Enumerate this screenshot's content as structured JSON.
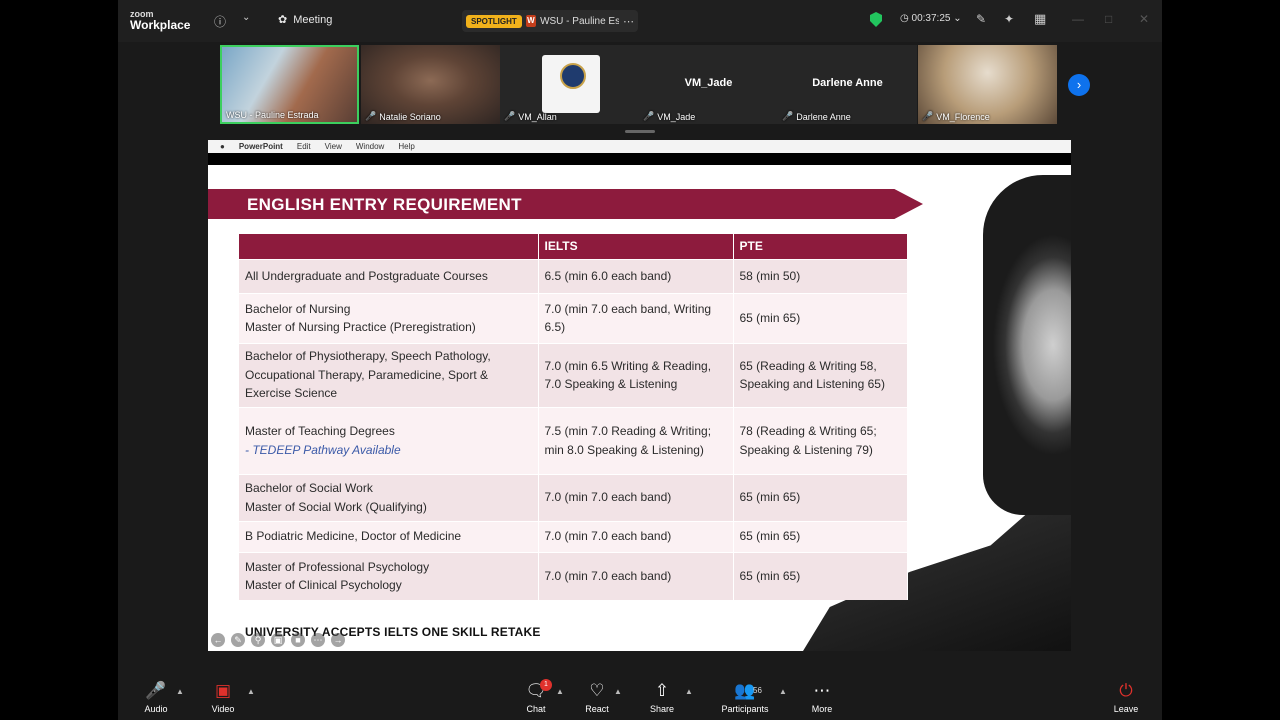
{
  "app": {
    "logo_top": "zoom",
    "logo_bottom": "Workplace"
  },
  "titlebar": {
    "meeting_label": "Meeting",
    "spotlight_badge": "SPOTLIGHT",
    "spotlight_title": "WSU - Pauline Es",
    "timer": "00:37:25",
    "icons": [
      "info-icon",
      "chevron-down-icon",
      "meeting-icon",
      "shield-icon",
      "clock-icon",
      "pencil-icon",
      "sparkle-icon",
      "grid-icon"
    ]
  },
  "participants_strip": [
    {
      "name": "WSU - Pauline Estrada",
      "muted": false,
      "type": "video"
    },
    {
      "name": "Natalie Soriano",
      "muted": true,
      "type": "video"
    },
    {
      "name": "VM_Allan",
      "muted": true,
      "type": "logo"
    },
    {
      "name": "VM_Jade",
      "muted": true,
      "type": "name",
      "display": "VM_Jade"
    },
    {
      "name": "Darlene Anne",
      "muted": true,
      "type": "name",
      "display": "Darlene Anne"
    },
    {
      "name": "VM_Florence",
      "muted": true,
      "type": "video"
    }
  ],
  "macbar": {
    "app": "PowerPoint",
    "menus": [
      "Edit",
      "View",
      "Window",
      "Help"
    ]
  },
  "slide": {
    "title": "ENGLISH ENTRY REQUIREMENT",
    "headers": [
      "",
      "IELTS",
      "PTE"
    ],
    "rows": [
      {
        "course": [
          "All Undergraduate and Postgraduate Courses"
        ],
        "ielts": [
          "6.5 (min 6.0 each band)"
        ],
        "pte": [
          "58 (min 50)"
        ]
      },
      {
        "course": [
          "Bachelor of Nursing",
          "Master of Nursing Practice (Preregistration)"
        ],
        "ielts": [
          "7.0 (min 7.0 each band, Writing",
          "6.5)"
        ],
        "pte": [
          "65 (min 65)"
        ]
      },
      {
        "course": [
          "Bachelor of Physiotherapy, Speech Pathology,",
          "Occupational Therapy, Paramedicine, Sport &",
          "Exercise Science"
        ],
        "ielts": [
          "7.0 (min 6.5 Writing & Reading,",
          "7.0 Speaking & Listening"
        ],
        "pte": [
          "65 (Reading & Writing 58,",
          "Speaking and Listening 65)"
        ]
      },
      {
        "course": [
          "Master of Teaching Degrees"
        ],
        "course_note": "- TEDEEP Pathway Available",
        "ielts": [
          "7.5 (min 7.0 Reading & Writing;",
          "min 8.0 Speaking & Listening)"
        ],
        "pte": [
          "78 (Reading & Writing 65;",
          "Speaking & Listening 79)"
        ]
      },
      {
        "course": [
          "Bachelor of Social Work",
          "Master of Social Work (Qualifying)"
        ],
        "ielts": [
          "7.0 (min 7.0 each band)"
        ],
        "pte": [
          "65 (min 65)"
        ]
      },
      {
        "course": [
          "B Podiatric Medicine, Doctor of Medicine"
        ],
        "ielts": [
          "7.0 (min 7.0 each band)"
        ],
        "pte": [
          "65 (min 65)"
        ]
      },
      {
        "course": [
          "Master of Professional Psychology",
          "Master of Clinical Psychology"
        ],
        "ielts": [
          "7.0 (min 7.0 each band)"
        ],
        "pte": [
          "65 (min 65)"
        ]
      }
    ],
    "footer": "UNIVERSITY ACCEPTS IELTS ONE SKILL RETAKE"
  },
  "toolbar": {
    "audio": "Audio",
    "video": "Video",
    "chat": "Chat",
    "chat_badge": "1",
    "react": "React",
    "share": "Share",
    "participants": "Participants",
    "participants_count": "56",
    "more": "More",
    "leave": "Leave"
  }
}
